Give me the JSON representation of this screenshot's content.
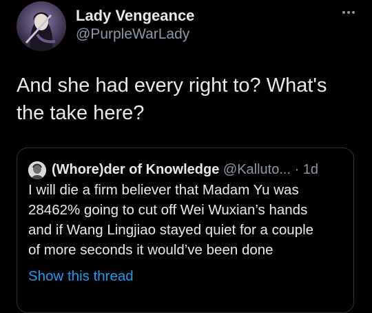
{
  "tweet": {
    "display_name": "Lady Vengeance",
    "handle": "@PurpleWarLady",
    "text": "And she had every right to? What's\nthe take here?",
    "more_icon": "more-horizontal-icon"
  },
  "quoted_tweet": {
    "name": "(Whore)der of Knowledge",
    "handle": "@Kalluto...",
    "time_separator": " · ",
    "time": "1d",
    "text": "I will die a firm believer that Madam Yu was\n28462% going to cut off Wei Wuxian’s hands\nand if Wang Lingjiao stayed quiet for a couple\nof more seconds it would’ve been done",
    "show_thread_label": "Show this thread"
  },
  "colors": {
    "background": "#000000",
    "primary_text": "#e7e9ea",
    "secondary_text": "#8b98a5",
    "link": "#1d9bf0",
    "border": "#2f3336"
  }
}
